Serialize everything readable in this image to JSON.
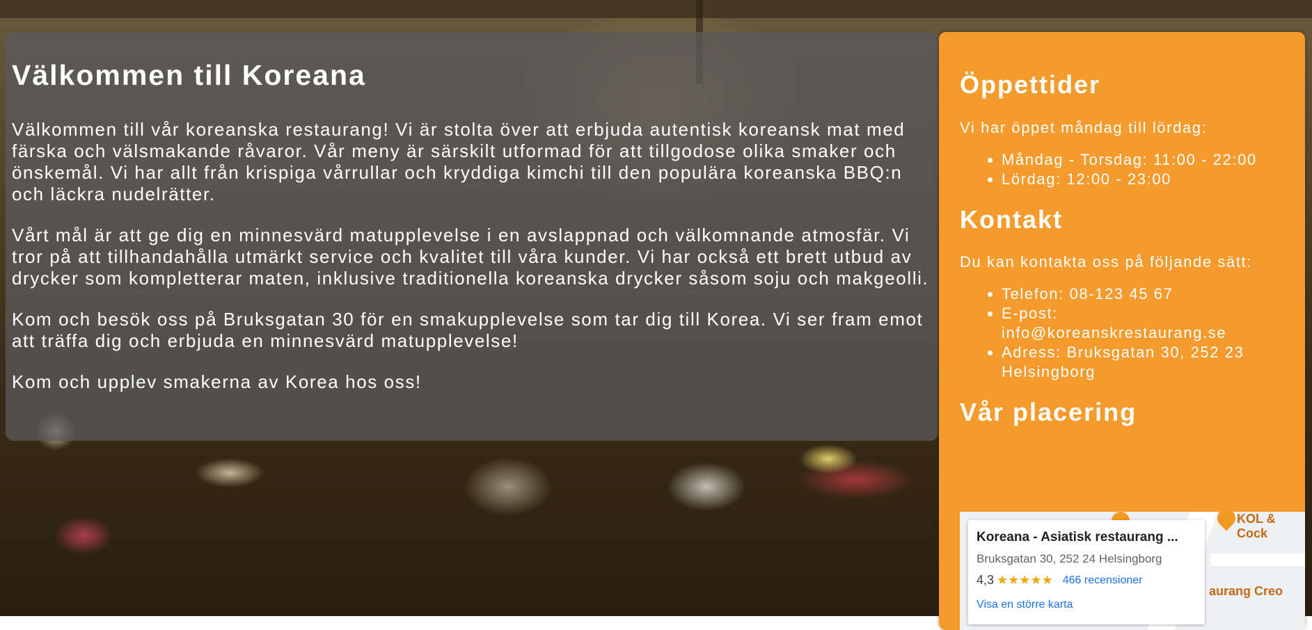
{
  "main": {
    "title": "Välkommen till Koreana",
    "paragraphs": [
      "Välkommen till vår koreanska restaurang! Vi är stolta över att erbjuda autentisk koreansk mat med färska och välsmakande råvaror. Vår meny är särskilt utformad för att tillgodose olika smaker och önskemål. Vi har allt från krispiga vårrullar och kryddiga kimchi till den populära koreanska BBQ:n och läckra nudelrätter.",
      "Vårt mål är att ge dig en minnesvärd matupplevelse i en avslappnad och välkomnande atmosfär. Vi tror på att tillhandahålla utmärkt service och kvalitet till våra kunder. Vi har också ett brett utbud av drycker som kompletterar maten, inklusive traditionella koreanska drycker såsom soju och makgeolli.",
      "Kom och besök oss på Bruksgatan 30 för en smakupplevelse som tar dig till Korea. Vi ser fram emot att träffa dig och erbjuda en minnesvärd matupplevelse!",
      "Kom och upplev smakerna av Korea hos oss!"
    ]
  },
  "sidebar": {
    "hours": {
      "heading": "Öppettider",
      "intro": "Vi har öppet måndag till lördag:",
      "items": [
        "Måndag - Torsdag: 11:00 - 22:00",
        "Lördag: 12:00 - 23:00"
      ]
    },
    "contact": {
      "heading": "Kontakt",
      "intro": "Du kan kontakta oss på följande sätt:",
      "items": [
        "Telefon: 08-123 45 67",
        "E-post: info@koreanskrestaurang.se",
        "Adress: Bruksgatan 30, 252 23 Helsingborg"
      ]
    },
    "location": {
      "heading": "Vår placering"
    }
  },
  "map": {
    "place_name": "Koreana - Asiatisk restaurang ...",
    "address": "Bruksgatan 30, 252 24 Helsingborg",
    "rating": "4,3",
    "stars": "★★★★★",
    "reviews": "466 recensioner",
    "bigger_map": "Visa en större karta",
    "poi_1": "KOL & Cock",
    "poi_2": "aurang Creo"
  },
  "colors": {
    "sidebar_bg": "#f59b2e",
    "main_overlay": "rgba(90,90,90,0.78)",
    "link": "#1a73e8"
  }
}
